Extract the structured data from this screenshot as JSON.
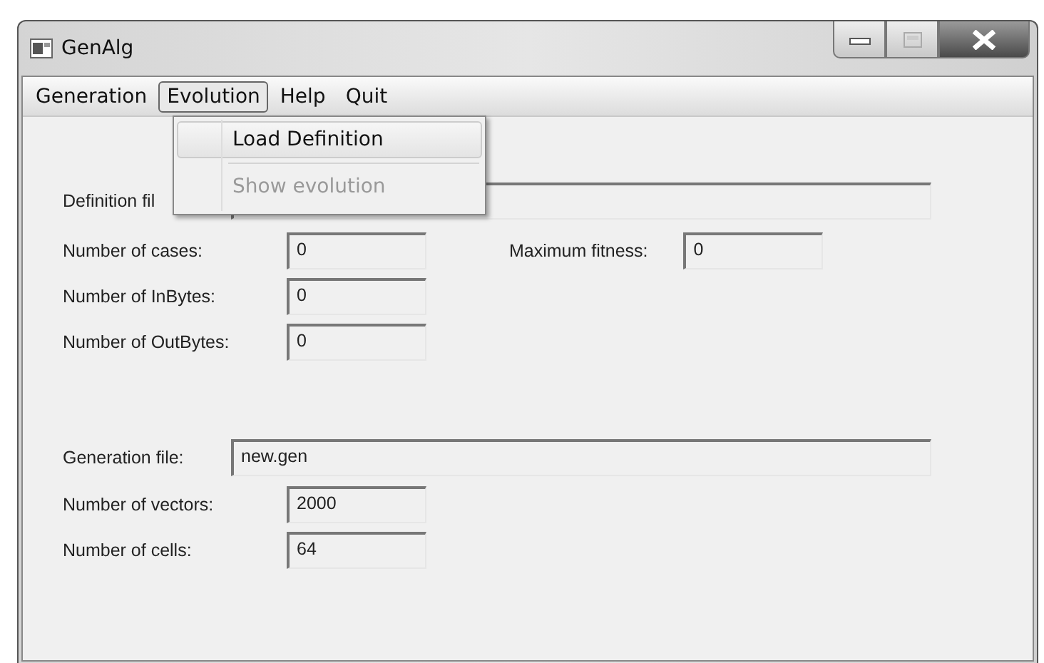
{
  "window": {
    "title": "GenAlg"
  },
  "menu": [
    {
      "label": "Generation",
      "selected": false
    },
    {
      "label": "Evolution",
      "selected": true
    },
    {
      "label": "Help",
      "selected": false
    },
    {
      "label": "Quit",
      "selected": false
    }
  ],
  "dropdown": [
    {
      "label": "Load Definition",
      "highlighted": true,
      "disabled": false
    },
    {
      "label": "Show evolution",
      "highlighted": false,
      "disabled": true
    }
  ],
  "definition_file": {
    "label": "Definition fil"
  },
  "definition_counts": [
    {
      "label": "Number of cases:",
      "value": "0"
    },
    {
      "label": "Number of InBytes:",
      "value": "0"
    },
    {
      "label": "Number of OutBytes:",
      "value": "0"
    }
  ],
  "maximum_fitness": {
    "label": "Maximum fitness:",
    "value": "0"
  },
  "generation_file": {
    "label": "Generation file:",
    "value": "new.gen"
  },
  "generation_counts": [
    {
      "label": "Number of vectors:",
      "value": "2000"
    },
    {
      "label": "Number of cells:",
      "value": "64"
    }
  ]
}
